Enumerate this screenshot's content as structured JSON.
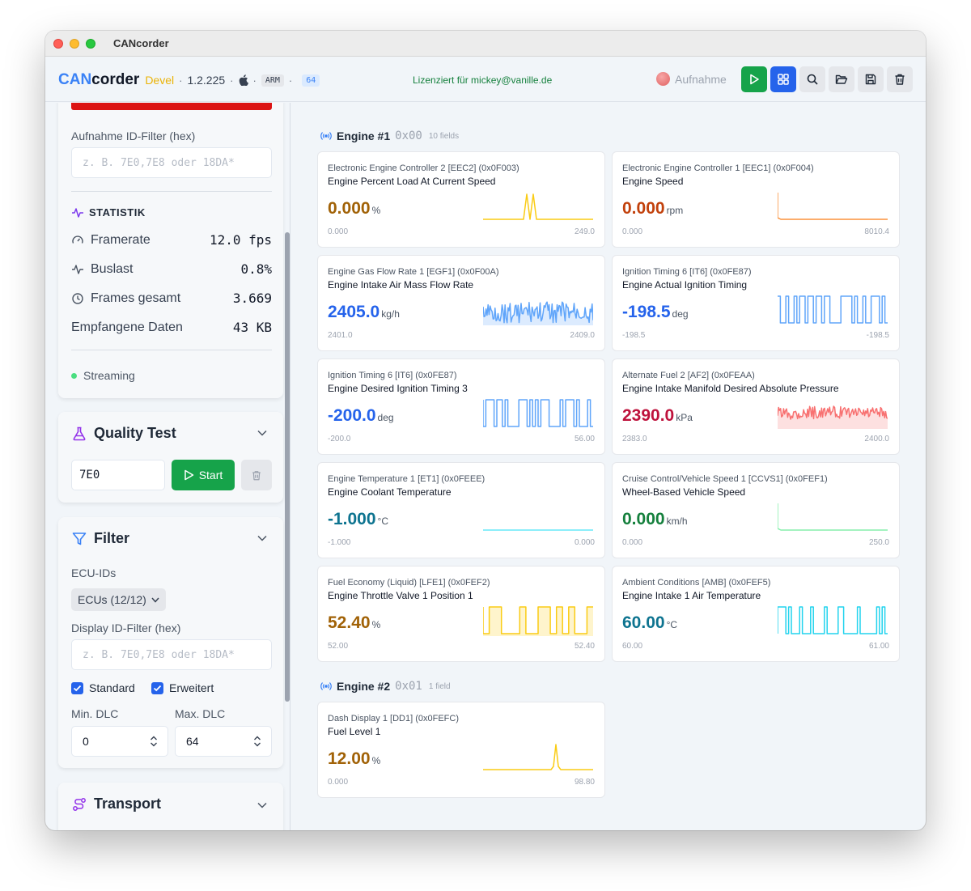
{
  "window": {
    "title": "CANcorder"
  },
  "header": {
    "brand_can": "CAN",
    "brand_corder": "corder",
    "channel": "Devel",
    "version": "1.2.225",
    "arch": "ARM",
    "bits": "64",
    "license": "Lizenziert für mickey@vanille.de",
    "record_label": "Aufnahme"
  },
  "sidebar": {
    "rec_filter_label": "Aufnahme ID-Filter (hex)",
    "rec_filter_placeholder": "z. B. 7E0,7E8 oder 18DA*",
    "stats": {
      "title": "STATISTIK",
      "framerate_label": "Framerate",
      "framerate_value": "12.0 fps",
      "busload_label": "Buslast",
      "busload_value": "0.8%",
      "frames_label": "Frames gesamt",
      "frames_value": "3.669",
      "data_label": "Empfangene Daten",
      "data_value": "43 KB",
      "status": "Streaming"
    },
    "quality": {
      "title": "Quality Test",
      "input_value": "7E0",
      "start_label": "Start"
    },
    "filter": {
      "title": "Filter",
      "ecu_label": "ECU-IDs",
      "ecu_button": "ECUs (12/12)",
      "display_filter_label": "Display ID-Filter (hex)",
      "display_filter_placeholder": "z. B. 7E0,7E8 oder 18DA*",
      "standard_label": "Standard",
      "extended_label": "Erweitert",
      "min_dlc_label": "Min. DLC",
      "min_dlc_value": "0",
      "max_dlc_label": "Max. DLC",
      "max_dlc_value": "64"
    },
    "transport": {
      "title": "Transport"
    }
  },
  "groups": [
    {
      "name": "Engine #1",
      "id": "0x00",
      "count": "10 fields",
      "cards": [
        {
          "source": "Electronic Engine Controller 2 [EEC2] (0x0F003)",
          "name": "Engine Percent Load At Current Speed",
          "value": "0.000",
          "unit": "%",
          "min": "0.000",
          "max": "249.0",
          "color": "#a16207",
          "line": "#facc15",
          "fill": false,
          "spark": "pulse2"
        },
        {
          "source": "Electronic Engine Controller 1 [EEC1] (0x0F004)",
          "name": "Engine Speed",
          "value": "0.000",
          "unit": "rpm",
          "min": "0.000",
          "max": "8010.4",
          "color": "#c2410c",
          "line": "#fb923c",
          "fill": false,
          "spark": "drop"
        },
        {
          "source": "Engine Gas Flow Rate 1 [EGF1] (0x0F00A)",
          "name": "Engine Intake Air Mass Flow Rate",
          "value": "2405.0",
          "unit": "kg/h",
          "min": "2401.0",
          "max": "2409.0",
          "color": "#2563eb",
          "line": "#60a5fa",
          "fill": true,
          "spark": "noise"
        },
        {
          "source": "Ignition Timing 6 [IT6] (0x0FE87)",
          "name": "Engine Actual Ignition Timing",
          "value": "-198.5",
          "unit": "deg",
          "min": "-198.5",
          "max": "-198.5",
          "color": "#2563eb",
          "line": "#60a5fa",
          "fill": false,
          "spark": "square"
        },
        {
          "source": "Ignition Timing 6 [IT6] (0x0FE87)",
          "name": "Engine Desired Ignition Timing 3",
          "value": "-200.0",
          "unit": "deg",
          "min": "-200.0",
          "max": "56.00",
          "color": "#2563eb",
          "line": "#60a5fa",
          "fill": false,
          "spark": "square2"
        },
        {
          "source": "Alternate Fuel 2 [AF2] (0x0FEAA)",
          "name": "Engine Intake Manifold Desired Absolute Pressure",
          "value": "2390.0",
          "unit": "kPa",
          "min": "2383.0",
          "max": "2400.0",
          "color": "#be123c",
          "line": "#f87171",
          "fill": true,
          "spark": "noise2"
        },
        {
          "source": "Engine Temperature 1 [ET1] (0x0FEEE)",
          "name": "Engine Coolant Temperature",
          "value": "-1.000",
          "unit": "°C",
          "min": "-1.000",
          "max": "0.000",
          "color": "#0e7490",
          "line": "#67e8f9",
          "fill": false,
          "spark": "flat"
        },
        {
          "source": "Cruise Control/Vehicle Speed 1 [CCVS1] (0x0FEF1)",
          "name": "Wheel-Based Vehicle Speed",
          "value": "0.000",
          "unit": "km/h",
          "min": "0.000",
          "max": "250.0",
          "color": "#15803d",
          "line": "#86efac",
          "fill": false,
          "spark": "drop"
        },
        {
          "source": "Fuel Economy (Liquid) [LFE1] (0x0FEF2)",
          "name": "Engine Throttle Valve 1 Position 1",
          "value": "52.40",
          "unit": "%",
          "min": "52.00",
          "max": "52.40",
          "color": "#a16207",
          "line": "#facc15",
          "fill": true,
          "spark": "square3"
        },
        {
          "source": "Ambient Conditions [AMB] (0x0FEF5)",
          "name": "Engine Intake 1 Air Temperature",
          "value": "60.00",
          "unit": "°C",
          "min": "60.00",
          "max": "61.00",
          "color": "#0e7490",
          "line": "#22d3ee",
          "fill": false,
          "spark": "pulses"
        }
      ]
    },
    {
      "name": "Engine #2",
      "id": "0x01",
      "count": "1 field",
      "cards": [
        {
          "source": "Dash Display 1 [DD1] (0x0FEFC)",
          "name": "Fuel Level 1",
          "value": "12.00",
          "unit": "%",
          "min": "0.000",
          "max": "98.80",
          "color": "#a16207",
          "line": "#facc15",
          "fill": false,
          "spark": "pulse1"
        }
      ]
    }
  ]
}
